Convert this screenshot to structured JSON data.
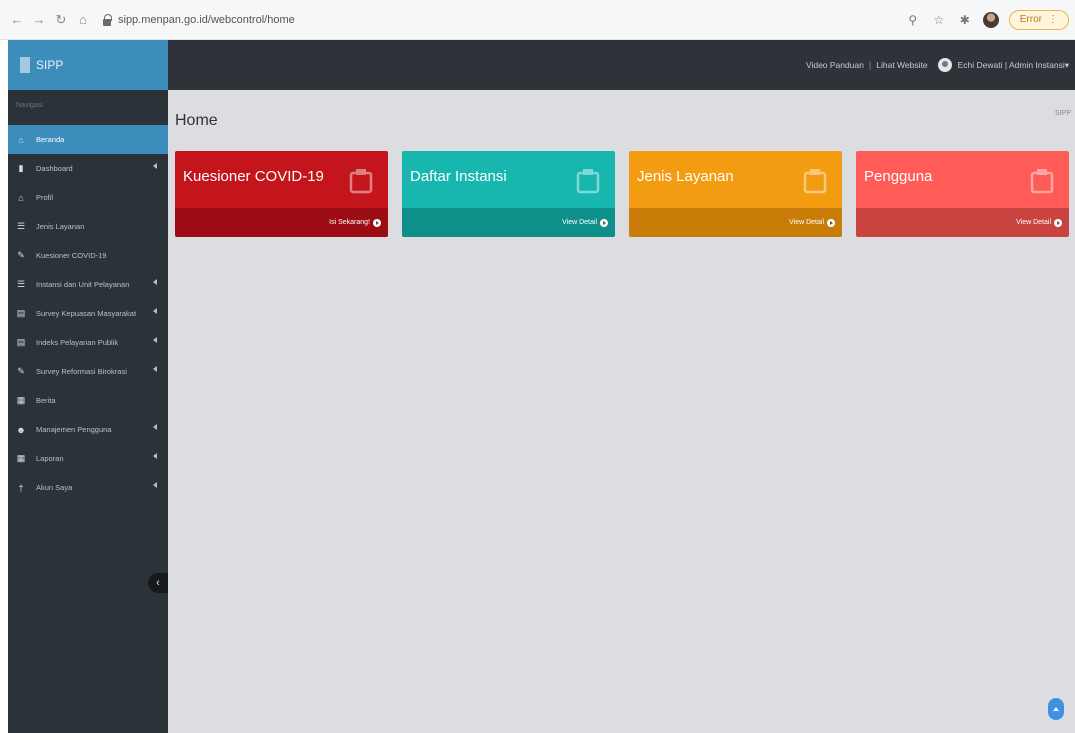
{
  "browser": {
    "url": "sipp.menpan.go.id/webcontrol/home",
    "error_label": "Error"
  },
  "app": {
    "logo_text": "SIPP",
    "top_links": [
      "Video Panduan",
      "Lihat Website"
    ],
    "user_label": "Echi Dewati | Admin Instansi"
  },
  "sidebar": {
    "section_label": "Navigasi",
    "items": [
      {
        "label": "Beranda",
        "icon": "home-icon",
        "active": true,
        "caret": false
      },
      {
        "label": "Dashboard",
        "icon": "chart-icon",
        "active": false,
        "caret": true
      },
      {
        "label": "Profil",
        "icon": "institution-icon",
        "active": false,
        "caret": false
      },
      {
        "label": "Jenis Layanan",
        "icon": "list-icon",
        "active": false,
        "caret": false
      },
      {
        "label": "Kuesioner COVID-19",
        "icon": "edit-icon",
        "active": false,
        "caret": false
      },
      {
        "label": "Instansi dan Unit Pelayanan",
        "icon": "list-icon",
        "active": false,
        "caret": true
      },
      {
        "label": "Survey Kepuasan Masyarakat",
        "icon": "bar-chart-icon",
        "active": false,
        "caret": true
      },
      {
        "label": "Indeks Pelayanan Publik",
        "icon": "document-icon",
        "active": false,
        "caret": true
      },
      {
        "label": "Survey Reformasi Birokrasi",
        "icon": "edit-icon",
        "active": false,
        "caret": true
      },
      {
        "label": "Berita",
        "icon": "newspaper-icon",
        "active": false,
        "caret": false
      },
      {
        "label": "Manajemen Pengguna",
        "icon": "users-icon",
        "active": false,
        "caret": true
      },
      {
        "label": "Laporan",
        "icon": "report-icon",
        "active": false,
        "caret": true
      },
      {
        "label": "Akun Saya",
        "icon": "user-icon",
        "active": false,
        "caret": true
      }
    ]
  },
  "content": {
    "page_title": "Home",
    "breadcrumb": "SIPP",
    "cards": [
      {
        "title": "Kuesioner COVID-19",
        "action": "Isi Sekarang!",
        "icon": "edit-icon",
        "color_top": "#c4151c",
        "color_bottom": "#9b0d12"
      },
      {
        "title": "Daftar Instansi",
        "action": "View Detail",
        "icon": "institution-icon",
        "color_top": "#17b7b0",
        "color_bottom": "#0f8f89"
      },
      {
        "title": "Jenis Layanan",
        "action": "View Detail",
        "icon": "gears-icon",
        "color_top": "#f39c12",
        "color_bottom": "#c97d08"
      },
      {
        "title": "Pengguna",
        "action": "View Detail",
        "icon": "users-icon",
        "color_top": "#ff5b57",
        "color_bottom": "#c94440"
      }
    ]
  }
}
